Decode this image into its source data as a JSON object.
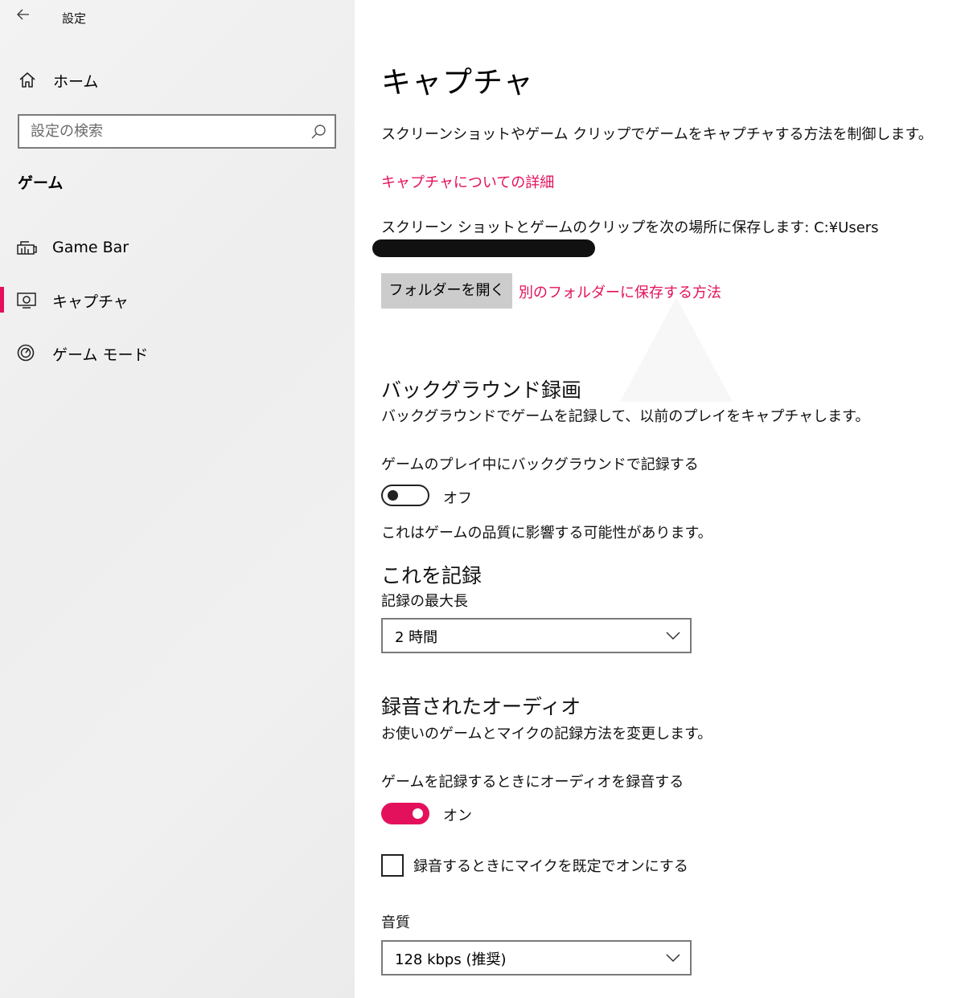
{
  "window": {
    "title": "設定",
    "back_icon": "arrow-left-icon"
  },
  "sidebar": {
    "home_label": "ホーム",
    "search_placeholder": "設定の検索",
    "section_heading": "ゲーム",
    "items": [
      {
        "label": "Game Bar",
        "icon": "game-bar-icon",
        "active": false
      },
      {
        "label": "キャプチャ",
        "icon": "capture-icon",
        "active": true
      },
      {
        "label": "ゲーム モード",
        "icon": "game-mode-icon",
        "active": false
      }
    ]
  },
  "main": {
    "title": "キャプチャ",
    "description": "スクリーンショットやゲーム クリップでゲームをキャプチャする方法を制御します。",
    "details_link": "キャプチャについての詳細",
    "save_location_text": "スクリーン ショットとゲームのクリップを次の場所に保存します: C:¥Users",
    "open_folder_button": "フォルダーを開く",
    "other_folder_link": "別のフォルダーに保存する方法",
    "background": {
      "heading": "バックグラウンド録画",
      "description": "バックグラウンドでゲームを記録して、以前のプレイをキャプチャします。",
      "toggle_label": "ゲームのプレイ中にバックグラウンドで記録する",
      "toggle_state": "オフ",
      "note": "これはゲームの品質に影響する可能性があります。"
    },
    "record_this": {
      "heading": "これを記録",
      "max_length_label": "記録の最大長",
      "max_length_value": "2 時間"
    },
    "audio": {
      "heading": "録音されたオーディオ",
      "description": "お使いのゲームとマイクの記録方法を変更します。",
      "toggle_label": "ゲームを記録するときにオーディオを録音する",
      "toggle_state": "オン",
      "mic_checkbox_label": "録音するときにマイクを既定でオンにする",
      "quality_label": "音質",
      "quality_value": "128 kbps (推奨)"
    }
  },
  "colors": {
    "accent": "#e3115c",
    "sidebar_bg": "#f0f0f0",
    "button_bg": "#cccccc"
  }
}
